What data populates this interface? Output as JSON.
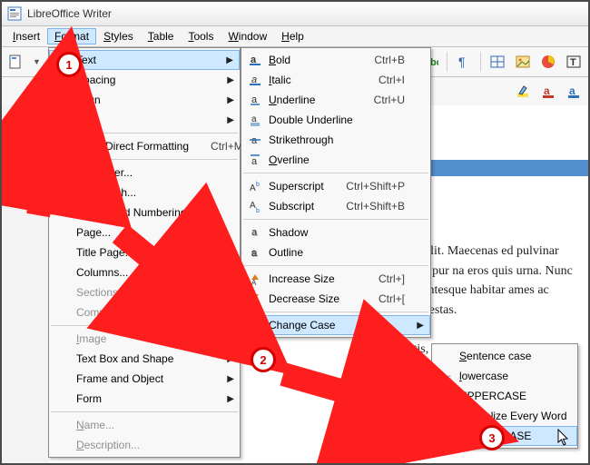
{
  "app": {
    "title": "LibreOffice Writer"
  },
  "menubar": {
    "items": [
      {
        "raw": "Insert",
        "u": "I",
        "rest": "nsert"
      },
      {
        "raw": "Format",
        "u": "F",
        "rest": "ormat",
        "open": true
      },
      {
        "raw": "Styles",
        "u": "S",
        "rest": "tyles"
      },
      {
        "raw": "Table",
        "u": "T",
        "rest": "able"
      },
      {
        "raw": "Tools",
        "u": "T",
        "rest": "ools"
      },
      {
        "raw": "Window",
        "u": "W",
        "rest": "indow"
      },
      {
        "raw": "Help",
        "u": "H",
        "rest": "elp"
      }
    ]
  },
  "format_menu": [
    {
      "hi": true,
      "label": "Text",
      "ul": "T",
      "rest": "ext",
      "submenu": true
    },
    {
      "label": "Spacing",
      "ul": "S",
      "rest": "pacing",
      "submenu": true
    },
    {
      "label": "Align",
      "rest": "Align",
      "submenu": true
    },
    {
      "label": "Lists",
      "ul": "L",
      "rest": "ists",
      "submenu": true
    },
    {
      "sep": true
    },
    {
      "label": "Clear Direct Formatting",
      "rest": "Clear Direct Formatting",
      "shortcut": "Ctrl+M"
    },
    {
      "sep": true
    },
    {
      "label": "Character...",
      "ul": "C",
      "rest": "haracter..."
    },
    {
      "label": "Paragraph...",
      "ul": "P",
      "rest": "aragraph..."
    },
    {
      "label": "Bullets and Numbering...",
      "ul": "B",
      "rest": "ullets and Numbering..."
    },
    {
      "label": "Page...",
      "rest": "Page..."
    },
    {
      "label": "Title Page...",
      "rest": "Title Page..."
    },
    {
      "label": "Columns...",
      "rest": "Columns..."
    },
    {
      "label": "Sections...",
      "rest": "Sections...",
      "disabled": true
    },
    {
      "label": "Comments...",
      "rest": "Comments...",
      "disabled": true
    },
    {
      "sep": true
    },
    {
      "label": "Image",
      "ul": "I",
      "rest": "mage",
      "submenu": true,
      "disabled": true
    },
    {
      "label": "Text Box and Shape",
      "rest": "Text Box and Shape",
      "submenu": true
    },
    {
      "label": "Frame and Object",
      "rest": "Frame and Object",
      "submenu": true
    },
    {
      "label": "Form",
      "rest": "Form",
      "submenu": true
    },
    {
      "sep": true
    },
    {
      "label": "Name...",
      "ul": "N",
      "rest": "ame...",
      "disabled": true
    },
    {
      "label": "Description...",
      "ul": "D",
      "rest": "escription...",
      "disabled": true
    }
  ],
  "text_menu": [
    {
      "label": "Bold",
      "ul": "B",
      "rest": "old",
      "shortcut": "Ctrl+B",
      "icon": "bold"
    },
    {
      "label": "Italic",
      "ul": "I",
      "rest": "talic",
      "shortcut": "Ctrl+I",
      "icon": "italic"
    },
    {
      "label": "Underline",
      "ul": "U",
      "rest": "nderline",
      "shortcut": "Ctrl+U",
      "icon": "underline"
    },
    {
      "label": "Double Underline",
      "rest": "Double Underline",
      "icon": "dblunder"
    },
    {
      "label": "Strikethrough",
      "rest": "Strikethrough",
      "icon": "strike"
    },
    {
      "label": "Overline",
      "ul": "O",
      "rest": "verline",
      "icon": "overline"
    },
    {
      "sep": true
    },
    {
      "label": "Superscript",
      "rest": "Superscript",
      "shortcut": "Ctrl+Shift+P",
      "icon": "sup"
    },
    {
      "label": "Subscript",
      "rest": "Subscript",
      "shortcut": "Ctrl+Shift+B",
      "icon": "sub"
    },
    {
      "sep": true
    },
    {
      "label": "Shadow",
      "rest": "Shadow",
      "icon": "shadow"
    },
    {
      "label": "Outline",
      "rest": "Outline",
      "icon": "outline"
    },
    {
      "sep": true
    },
    {
      "label": "Increase Size",
      "rest": "Increase Size",
      "shortcut": "Ctrl+]",
      "icon": "inc"
    },
    {
      "label": "Decrease Size",
      "rest": "Decrease Size",
      "shortcut": "Ctrl+[",
      "icon": "dec"
    },
    {
      "sep": true
    },
    {
      "hi": true,
      "label": "Change Case",
      "rest": "Change Case",
      "submenu": true
    }
  ],
  "case_menu": [
    {
      "label": "Sentence case",
      "ul": "S",
      "rest": "entence case"
    },
    {
      "label": "lowercase",
      "ul": "l",
      "rest": "owercase",
      "icon": "lc"
    },
    {
      "label": "UPPERCASE",
      "ul": "U",
      "rest": "PPERCASE",
      "icon": "uc"
    },
    {
      "label": "Capitalize Every Word",
      "ul": "C",
      "rest": "apitalize Every Word"
    },
    {
      "hi": true,
      "label": "tOGGLE cASE",
      "ul": "t",
      "rest": "OGGLE cASE"
    }
  ],
  "document_text": "piscing elit. Maecenas ed pulvinar ultricies, pur na eros quis urna. Nunc us. Pellentesque habitar ames ac turpis egestas.\n\nn mattis, nunc. Mauris nunc. Fusce aliquet p ue magna nnndin eles ac imperdiet at d eget sapien.",
  "badges": {
    "1": "1",
    "2": "2",
    "3": "3"
  }
}
